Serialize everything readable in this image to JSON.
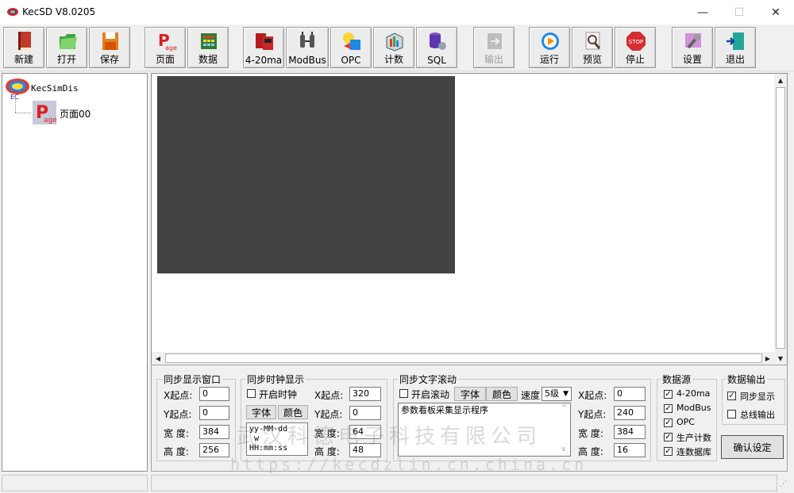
{
  "window": {
    "title": "KecSD V8.0205",
    "minimize": "—",
    "maximize": "☐",
    "close": "✕"
  },
  "toolbar": [
    {
      "id": "new",
      "label": "新建",
      "icon": "book-icon"
    },
    {
      "id": "open",
      "label": "打开",
      "icon": "folder-icon"
    },
    {
      "id": "save",
      "label": "保存",
      "icon": "floppy-icon"
    },
    {
      "id": "page",
      "label": "页面",
      "icon": "page-icon"
    },
    {
      "id": "data",
      "label": "数据",
      "icon": "grid-icon"
    },
    {
      "id": "ma",
      "label": "4-20ma",
      "icon": "meter-icon"
    },
    {
      "id": "modbus",
      "label": "ModBus",
      "icon": "plug-icon"
    },
    {
      "id": "opc",
      "label": "OPC",
      "icon": "opc-icon"
    },
    {
      "id": "count",
      "label": "计数",
      "icon": "box-icon"
    },
    {
      "id": "sql",
      "label": "SQL",
      "icon": "database-icon"
    },
    {
      "id": "output",
      "label": "输出",
      "icon": "export-icon",
      "disabled": true
    },
    {
      "id": "run",
      "label": "运行",
      "icon": "play-icon"
    },
    {
      "id": "preview",
      "label": "预览",
      "icon": "magnifier-icon"
    },
    {
      "id": "stop",
      "label": "停止",
      "icon": "stop-icon"
    },
    {
      "id": "settings",
      "label": "设置",
      "icon": "wrench-icon"
    },
    {
      "id": "exit",
      "label": "退出",
      "icon": "door-icon"
    }
  ],
  "tree": {
    "root": "KecSimDis",
    "child": "页面00"
  },
  "sync_window": {
    "title": "同步显示窗口",
    "x_label": "X起点:",
    "x": "0",
    "y_label": "Y起点:",
    "y": "0",
    "w_label": "宽  度:",
    "w": "384",
    "h_label": "高  度:",
    "h": "256"
  },
  "clock": {
    "title": "同步时钟显示",
    "enable": "开启时钟",
    "font_btn": "字体",
    "color_btn": "颜色",
    "format": "yy-MM-dd\n w\nHH:mm:ss",
    "x_label": "X起点:",
    "x": "320",
    "y_label": "Y起点:",
    "y": "0",
    "w_label": "宽  度:",
    "w": "64",
    "h_label": "高  度:",
    "h": "48"
  },
  "scroll_text": {
    "title": "同步文字滚动",
    "enable": "开启滚动",
    "font_btn": "字体",
    "color_btn": "颜色",
    "speed_label": "速度",
    "speed": "5级",
    "text": "参数看板采集显示程序",
    "x_label": "X起点:",
    "x": "0",
    "y_label": "Y起点:",
    "y": "240",
    "w_label": "宽  度:",
    "w": "384",
    "h_label": "高  度:",
    "h": "16"
  },
  "sources": {
    "title": "数据源",
    "items": [
      {
        "label": "4-20ma",
        "checked": true
      },
      {
        "label": "ModBus",
        "checked": true
      },
      {
        "label": "OPC",
        "checked": true
      },
      {
        "label": "生产计数",
        "checked": true
      },
      {
        "label": "连数据库",
        "checked": true
      }
    ]
  },
  "output": {
    "title": "数据输出",
    "items": [
      {
        "label": "同步显示",
        "checked": true
      },
      {
        "label": "总线输出",
        "checked": false
      }
    ],
    "confirm": "确认设定"
  },
  "watermark": {
    "line1": "武汉科德电子科技有限公司",
    "line2": "https://kecdzlin.cn.china.cn"
  }
}
